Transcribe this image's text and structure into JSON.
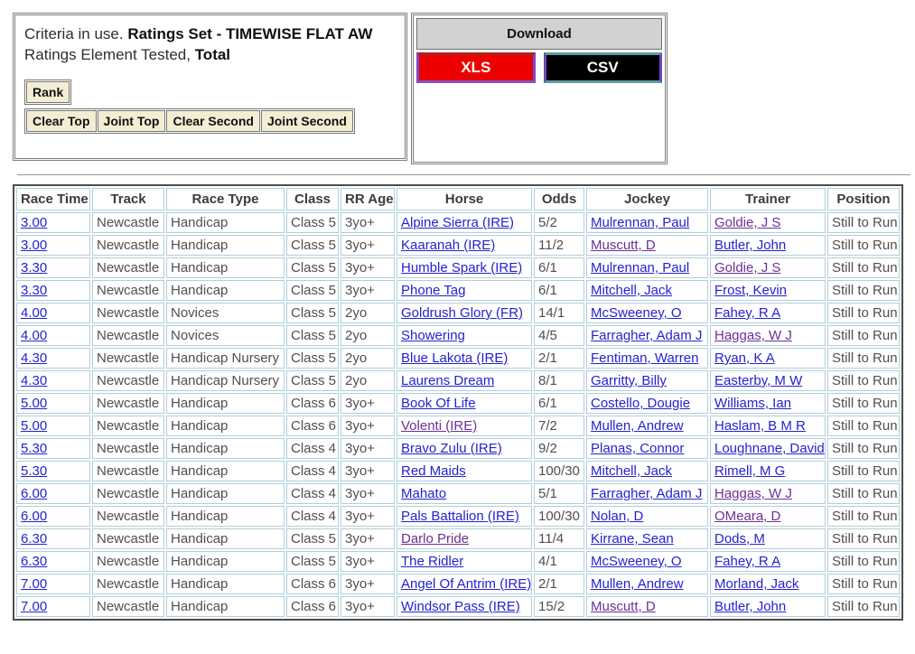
{
  "criteria": {
    "line1_prefix": "Criteria in use. ",
    "line1_bold": "Ratings Set - TIMEWISE FLAT AW",
    "line2_prefix": "Ratings Element Tested, ",
    "line2_bold": "Total",
    "rank_button": "Rank",
    "buttons": [
      "Clear Top",
      "Joint Top",
      "Clear Second",
      "Joint Second"
    ]
  },
  "download": {
    "title": "Download",
    "xls_label": "XLS",
    "csv_label": "CSV"
  },
  "colors": {
    "link": "#2422cf",
    "visited": "#6d2f96",
    "xls_bg": "#ee0000",
    "csv_bg": "#000000",
    "cell_border": "#b0cedd",
    "button_bg": "#f3edd3",
    "download_header_bg": "#d2d2d2"
  },
  "table": {
    "headers": [
      "Race Time",
      "Track",
      "Race Type",
      "Class",
      "RR Age",
      "Horse",
      "Odds",
      "Jockey",
      "Trainer",
      "Position"
    ],
    "rows": [
      {
        "time": "3.00",
        "track": "Newcastle",
        "type": "Handicap",
        "cls": "Class 5",
        "age": "3yo+",
        "horse": "Alpine Sierra (IRE)",
        "horse_v": false,
        "odds": "5/2",
        "jockey": "Mulrennan, Paul",
        "jockey_v": false,
        "trainer": "Goldie, J S",
        "trainer_v": true,
        "position": "Still to Run"
      },
      {
        "time": "3.00",
        "track": "Newcastle",
        "type": "Handicap",
        "cls": "Class 5",
        "age": "3yo+",
        "horse": "Kaaranah (IRE)",
        "horse_v": false,
        "odds": "11/2",
        "jockey": "Muscutt, D",
        "jockey_v": true,
        "trainer": "Butler, John",
        "trainer_v": false,
        "position": "Still to Run"
      },
      {
        "time": "3.30",
        "track": "Newcastle",
        "type": "Handicap",
        "cls": "Class 5",
        "age": "3yo+",
        "horse": "Humble Spark (IRE)",
        "horse_v": false,
        "odds": "6/1",
        "jockey": "Mulrennan, Paul",
        "jockey_v": false,
        "trainer": "Goldie, J S",
        "trainer_v": true,
        "position": "Still to Run"
      },
      {
        "time": "3.30",
        "track": "Newcastle",
        "type": "Handicap",
        "cls": "Class 5",
        "age": "3yo+",
        "horse": "Phone Tag",
        "horse_v": false,
        "odds": "6/1",
        "jockey": "Mitchell, Jack",
        "jockey_v": false,
        "trainer": "Frost, Kevin",
        "trainer_v": false,
        "position": "Still to Run"
      },
      {
        "time": "4.00",
        "track": "Newcastle",
        "type": "Novices",
        "cls": "Class 5",
        "age": "2yo",
        "horse": "Goldrush Glory (FR)",
        "horse_v": false,
        "odds": "14/1",
        "jockey": "McSweeney, O",
        "jockey_v": false,
        "trainer": "Fahey, R A",
        "trainer_v": false,
        "position": "Still to Run"
      },
      {
        "time": "4.00",
        "track": "Newcastle",
        "type": "Novices",
        "cls": "Class 5",
        "age": "2yo",
        "horse": "Showering",
        "horse_v": false,
        "odds": "4/5",
        "jockey": "Farragher, Adam J",
        "jockey_v": false,
        "trainer": "Haggas, W J",
        "trainer_v": true,
        "position": "Still to Run"
      },
      {
        "time": "4.30",
        "track": "Newcastle",
        "type": "Handicap Nursery",
        "cls": "Class 5",
        "age": "2yo",
        "horse": "Blue Lakota (IRE)",
        "horse_v": false,
        "odds": "2/1",
        "jockey": "Fentiman, Warren",
        "jockey_v": false,
        "trainer": "Ryan, K A",
        "trainer_v": false,
        "position": "Still to Run"
      },
      {
        "time": "4.30",
        "track": "Newcastle",
        "type": "Handicap Nursery",
        "cls": "Class 5",
        "age": "2yo",
        "horse": "Laurens Dream",
        "horse_v": false,
        "odds": "8/1",
        "jockey": "Garritty, Billy",
        "jockey_v": false,
        "trainer": "Easterby, M W",
        "trainer_v": false,
        "position": "Still to Run"
      },
      {
        "time": "5.00",
        "track": "Newcastle",
        "type": "Handicap",
        "cls": "Class 6",
        "age": "3yo+",
        "horse": "Book Of Life",
        "horse_v": false,
        "odds": "6/1",
        "jockey": "Costello, Dougie",
        "jockey_v": false,
        "trainer": "Williams, Ian",
        "trainer_v": false,
        "position": "Still to Run"
      },
      {
        "time": "5.00",
        "track": "Newcastle",
        "type": "Handicap",
        "cls": "Class 6",
        "age": "3yo+",
        "horse": "Volenti (IRE)",
        "horse_v": true,
        "odds": "7/2",
        "jockey": "Mullen, Andrew",
        "jockey_v": false,
        "trainer": "Haslam, B M R",
        "trainer_v": false,
        "position": "Still to Run"
      },
      {
        "time": "5.30",
        "track": "Newcastle",
        "type": "Handicap",
        "cls": "Class 4",
        "age": "3yo+",
        "horse": "Bravo Zulu (IRE)",
        "horse_v": false,
        "odds": "9/2",
        "jockey": "Planas, Connor",
        "jockey_v": false,
        "trainer": "Loughnane, David",
        "trainer_v": false,
        "position": "Still to Run"
      },
      {
        "time": "5.30",
        "track": "Newcastle",
        "type": "Handicap",
        "cls": "Class 4",
        "age": "3yo+",
        "horse": "Red Maids",
        "horse_v": false,
        "odds": "100/30",
        "jockey": "Mitchell, Jack",
        "jockey_v": false,
        "trainer": "Rimell, M G",
        "trainer_v": false,
        "position": "Still to Run"
      },
      {
        "time": "6.00",
        "track": "Newcastle",
        "type": "Handicap",
        "cls": "Class 4",
        "age": "3yo+",
        "horse": "Mahato",
        "horse_v": false,
        "odds": "5/1",
        "jockey": "Farragher, Adam J",
        "jockey_v": false,
        "trainer": "Haggas, W J",
        "trainer_v": true,
        "position": "Still to Run"
      },
      {
        "time": "6.00",
        "track": "Newcastle",
        "type": "Handicap",
        "cls": "Class 4",
        "age": "3yo+",
        "horse": "Pals Battalion (IRE)",
        "horse_v": false,
        "odds": "100/30",
        "jockey": "Nolan, D",
        "jockey_v": false,
        "trainer": "OMeara, D",
        "trainer_v": true,
        "position": "Still to Run"
      },
      {
        "time": "6.30",
        "track": "Newcastle",
        "type": "Handicap",
        "cls": "Class 5",
        "age": "3yo+",
        "horse": "Darlo Pride",
        "horse_v": true,
        "odds": "11/4",
        "jockey": "Kirrane, Sean",
        "jockey_v": false,
        "trainer": "Dods, M",
        "trainer_v": false,
        "position": "Still to Run"
      },
      {
        "time": "6.30",
        "track": "Newcastle",
        "type": "Handicap",
        "cls": "Class 5",
        "age": "3yo+",
        "horse": "The Ridler",
        "horse_v": false,
        "odds": "4/1",
        "jockey": "McSweeney, O",
        "jockey_v": false,
        "trainer": "Fahey, R A",
        "trainer_v": false,
        "position": "Still to Run"
      },
      {
        "time": "7.00",
        "track": "Newcastle",
        "type": "Handicap",
        "cls": "Class 6",
        "age": "3yo+",
        "horse": "Angel Of Antrim (IRE)",
        "horse_v": false,
        "odds": "2/1",
        "jockey": "Mullen, Andrew",
        "jockey_v": false,
        "trainer": "Morland, Jack",
        "trainer_v": false,
        "position": "Still to Run"
      },
      {
        "time": "7.00",
        "track": "Newcastle",
        "type": "Handicap",
        "cls": "Class 6",
        "age": "3yo+",
        "horse": "Windsor Pass (IRE)",
        "horse_v": false,
        "odds": "15/2",
        "jockey": "Muscutt, D",
        "jockey_v": true,
        "trainer": "Butler, John",
        "trainer_v": false,
        "position": "Still to Run"
      }
    ]
  }
}
